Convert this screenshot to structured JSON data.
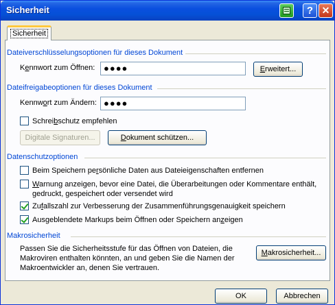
{
  "window": {
    "title": "Sicherheit",
    "help_glyph": "?",
    "close_glyph": "✕"
  },
  "tab": {
    "label": "Sicherheit"
  },
  "encryption": {
    "heading": "Dateiverschlüsselungsoptionen für dieses Dokument",
    "label_pre": "K",
    "label_u": "e",
    "label_post": "nnwort zum Öffnen:",
    "value": "●●●●",
    "advanced_pre": "",
    "advanced_u": "E",
    "advanced_post": "rweitert..."
  },
  "sharing": {
    "heading": "Dateifreigabeoptionen für dieses Dokument",
    "label_pre": "Kennw",
    "label_u": "o",
    "label_post": "rt zum Ändern:",
    "value": "●●●●",
    "readonly_pre": "Schrei",
    "readonly_u": "b",
    "readonly_post": "schutz empfehlen",
    "readonly_checked": false,
    "digital_signatures": "Digitale Signaturen...",
    "protect_pre": "",
    "protect_u": "D",
    "protect_post": "okument schützen..."
  },
  "privacy": {
    "heading": "Datenschutzoptionen",
    "opt1_pre": "Beim Speichern pe",
    "opt1_u": "r",
    "opt1_post": "sönliche Daten aus Dateieigenschaften entfernen",
    "opt2_pre": "",
    "opt2_u": "W",
    "opt2_post": "arnung anzeigen, bevor eine Datei, die Überarbeitungen oder Kommentare enthält,",
    "opt2_line2": "gedruckt, gespeichert oder versendet wird",
    "opt3_pre": "Zu",
    "opt3_u": "f",
    "opt3_post": "allszahl zur Verbesserung der Zusammenführungsgenauigkeit speichern",
    "opt4_pre": "Ausgeblendete Markups beim Öffnen oder Speichern an",
    "opt4_u": "z",
    "opt4_post": "eigen"
  },
  "macro": {
    "heading": "Makrosicherheit",
    "line1": "Passen Sie die Sicherheitsstufe für das Öffnen von Dateien, die",
    "line2": "Makroviren enthalten könnten, an und geben Sie die Namen der",
    "line3": "Makroentwickler an, denen Sie vertrauen.",
    "button_pre": "",
    "button_u": "M",
    "button_post": "akrosicherheit..."
  },
  "footer": {
    "ok": "OK",
    "cancel": "Abbrechen"
  }
}
